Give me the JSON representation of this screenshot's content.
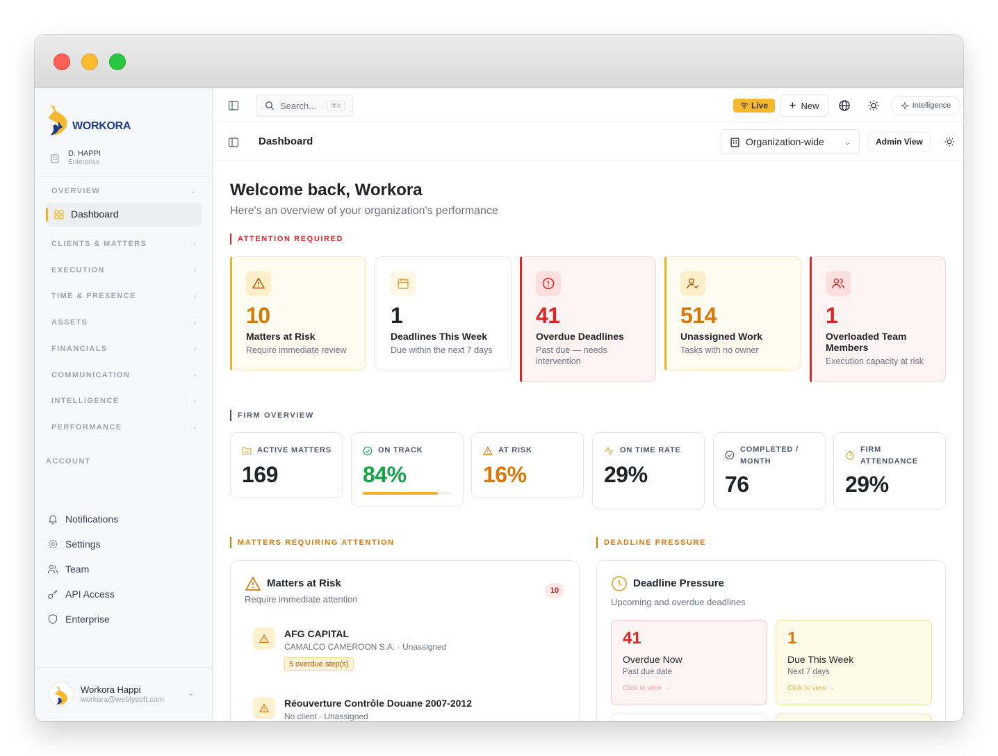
{
  "brand": {
    "name": "WORKORA"
  },
  "org": {
    "name": "D. HAPPI",
    "plan": "Enterprise"
  },
  "sidebar": {
    "groups": [
      {
        "label": "OVERVIEW",
        "icon": "chevron-down-icon"
      },
      {
        "label": "CLIENTS & MATTERS",
        "icon": "chevron-right-icon"
      },
      {
        "label": "EXECUTION",
        "icon": "chevron-right-icon"
      },
      {
        "label": "TIME & PRESENCE",
        "icon": "chevron-right-icon"
      },
      {
        "label": "ASSETS",
        "icon": "chevron-right-icon"
      },
      {
        "label": "FINANCIALS",
        "icon": "chevron-right-icon"
      },
      {
        "label": "COMMUNICATION",
        "icon": "chevron-right-icon"
      },
      {
        "label": "INTELLIGENCE",
        "icon": "chevron-right-icon"
      },
      {
        "label": "PERFORMANCE",
        "icon": "chevron-right-icon"
      }
    ],
    "active_item": "Dashboard",
    "account_title": "ACCOUNT",
    "account_items": [
      {
        "label": "Notifications",
        "icon": "bell-icon"
      },
      {
        "label": "Settings",
        "icon": "gear-icon"
      },
      {
        "label": "Team",
        "icon": "users-icon"
      },
      {
        "label": "API Access",
        "icon": "key-icon"
      },
      {
        "label": "Enterprise",
        "icon": "shield-icon"
      }
    ],
    "user": {
      "name": "Workora Happi",
      "email": "workora@weblysoft.com"
    }
  },
  "topbar": {
    "search_placeholder": "Search...",
    "search_shortcut": "⌘K",
    "live_label": "Live",
    "new_label": "New",
    "intelligence_label": "Intelligence"
  },
  "subbar": {
    "title": "Dashboard",
    "scope": "Organization-wide",
    "admin_view": "Admin View"
  },
  "welcome": {
    "title": "Welcome back, Workora",
    "subtitle": "Here's an overview of your organization's performance"
  },
  "attention": {
    "label": "ATTENTION REQUIRED",
    "cards": [
      {
        "value": "10",
        "title": "Matters at Risk",
        "desc": "Require immediate review",
        "icon": "warning-triangle-icon",
        "tone": "amber"
      },
      {
        "value": "1",
        "title": "Deadlines This Week",
        "desc": "Due within the next 7 days",
        "icon": "calendar-icon",
        "tone": "neutral"
      },
      {
        "value": "41",
        "title": "Overdue Deadlines",
        "desc": "Past due — needs intervention",
        "icon": "alert-circle-icon",
        "tone": "red"
      },
      {
        "value": "514",
        "title": "Unassigned Work",
        "desc": "Tasks with no owner",
        "icon": "user-check-icon",
        "tone": "amber"
      },
      {
        "value": "1",
        "title": "Overloaded Team Members",
        "desc": "Execution capacity at risk",
        "icon": "users-icon",
        "tone": "red"
      }
    ]
  },
  "firm_overview": {
    "label": "FIRM OVERVIEW",
    "cards": [
      {
        "label": "ACTIVE MATTERS",
        "value": "169",
        "icon": "folder-icon"
      },
      {
        "label": "ON TRACK",
        "value": "84%",
        "icon": "check-circle-icon",
        "progress": 0.84
      },
      {
        "label": "AT RISK",
        "value": "16%",
        "icon": "warning-triangle-icon"
      },
      {
        "label": "ON TIME RATE",
        "value": "29%",
        "icon": "activity-icon"
      },
      {
        "label": "COMPLETED / MONTH",
        "value": "76",
        "icon": "check-circle-icon"
      },
      {
        "label": "FIRM ATTENDANCE",
        "value": "29%",
        "icon": "stopwatch-icon"
      }
    ]
  },
  "matters_panel": {
    "section_label": "MATTERS REQUIRING ATTENTION",
    "title": "Matters at Risk",
    "subtitle": "Require immediate attention",
    "count": "10",
    "rows": [
      {
        "title": "AFG CAPITAL",
        "sub": "CAMALCO CAMEROON S.A. · Unassigned",
        "tag": "5 overdue step(s)"
      },
      {
        "title": "Réouverture Contrôle Douane 2007-2012",
        "sub": "No client · Unassigned"
      }
    ]
  },
  "deadline_panel": {
    "section_label": "DEADLINE PRESSURE",
    "title": "Deadline Pressure",
    "subtitle": "Upcoming and overdue deadlines",
    "cards": [
      {
        "value": "41",
        "title": "Overdue Now",
        "desc": "Past due date",
        "link": "Click to view →"
      },
      {
        "value": "1",
        "title": "Due This Week",
        "desc": "Next 7 days",
        "link": "Click to view →"
      }
    ]
  },
  "colors": {
    "amber": "#d97706",
    "red": "#dc2626",
    "green": "#16a34a",
    "brand_yellow": "#f5b82e",
    "brand_blue": "#1d3a8a"
  }
}
